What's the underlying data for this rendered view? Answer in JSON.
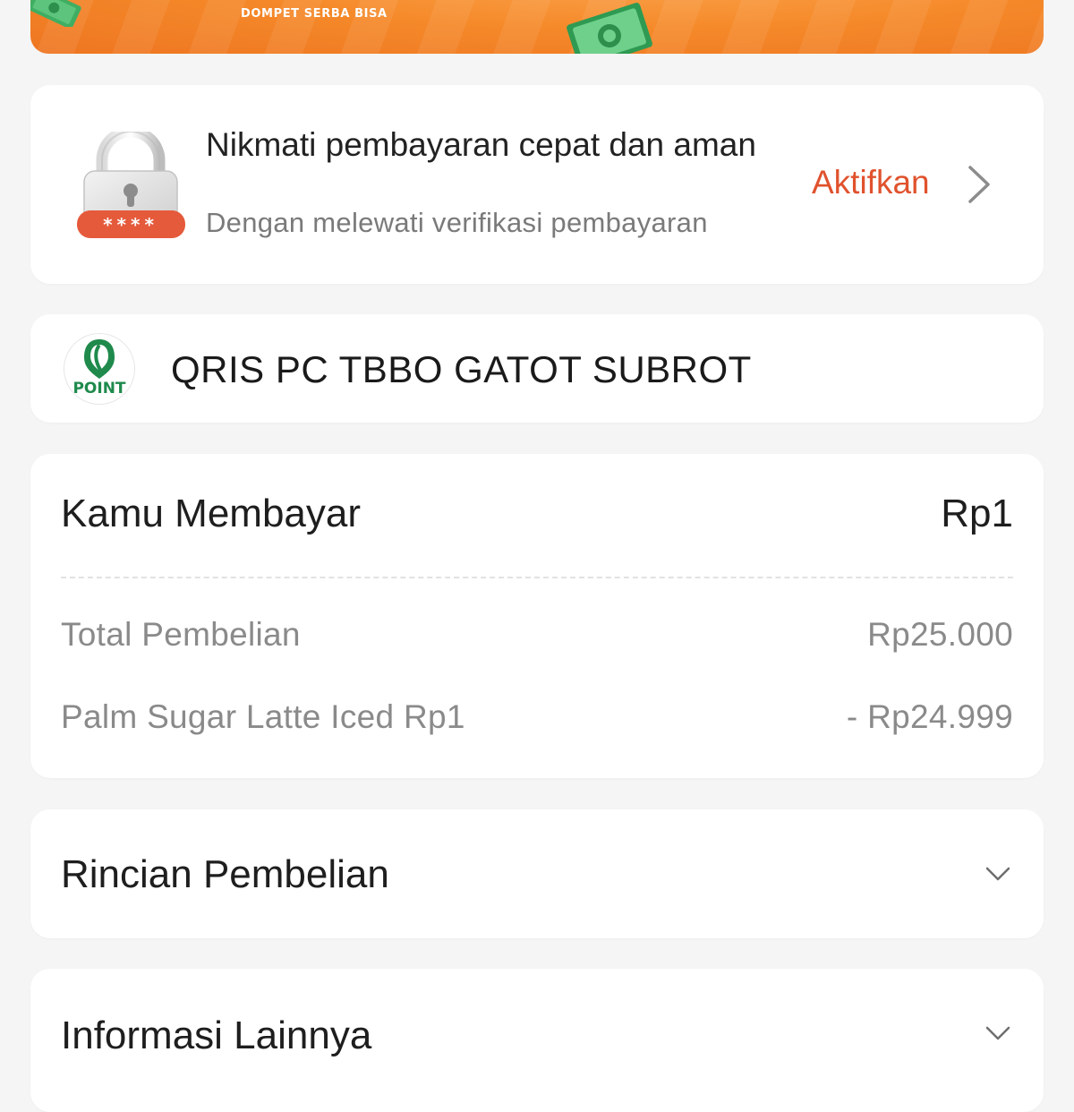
{
  "banner": {
    "tagline": "DOMPET SERBA BISA"
  },
  "security_prompt": {
    "title": "Nikmati pembayaran cepat dan aman",
    "subtitle": "Dengan melewati verifikasi pembayaran",
    "action_label": "Aktifkan",
    "icon": "lock-icon",
    "pin_mask": "****"
  },
  "merchant": {
    "name": "QRIS PC TBBO GATOT SUBROT",
    "logo_text": "POINT",
    "logo_icon": "coffee-bean-icon"
  },
  "payment": {
    "label": "Kamu Membayar",
    "amount": "Rp1",
    "rows": [
      {
        "label": "Total Pembelian",
        "value": "Rp25.000"
      },
      {
        "label": "Palm Sugar Latte Iced Rp1",
        "value": "- Rp24.999"
      }
    ]
  },
  "sections": {
    "details_title": "Rincian Pembelian",
    "info_title": "Informasi Lainnya"
  },
  "colors": {
    "accent": "#e0522d",
    "banner_orange": "#f58a2a",
    "page_background": "#f5f5f5",
    "merchant_green": "#1f8a4c"
  }
}
